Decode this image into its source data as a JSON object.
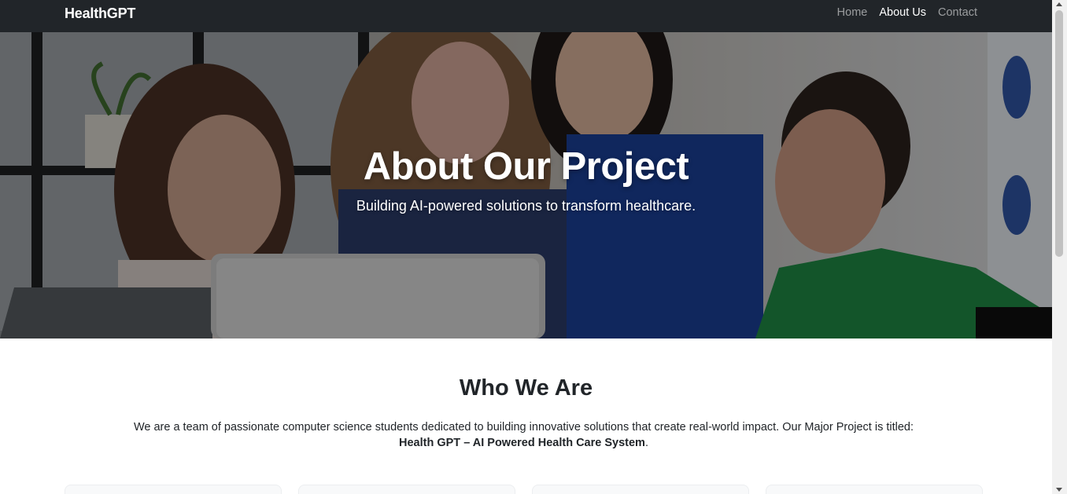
{
  "navbar": {
    "brand": "HealthGPT",
    "links": [
      {
        "label": "Home",
        "active": false
      },
      {
        "label": "About Us",
        "active": true
      },
      {
        "label": "Contact",
        "active": false
      }
    ]
  },
  "hero": {
    "title": "About Our Project",
    "subtitle": "Building AI-powered solutions to transform healthcare."
  },
  "about": {
    "title": "Who We Are",
    "text": "We are a team of passionate computer science students dedicated to building innovative solutions that create real-world impact. Our Major Project is titled:",
    "project_name": "Health GPT – AI Powered Health Care System",
    "suffix": "."
  },
  "colors": {
    "navbar_bg": "#212529",
    "nav_link_inactive": "rgba(255,255,255,0.55)",
    "nav_link_active": "#ffffff",
    "text_dark": "#212529"
  }
}
